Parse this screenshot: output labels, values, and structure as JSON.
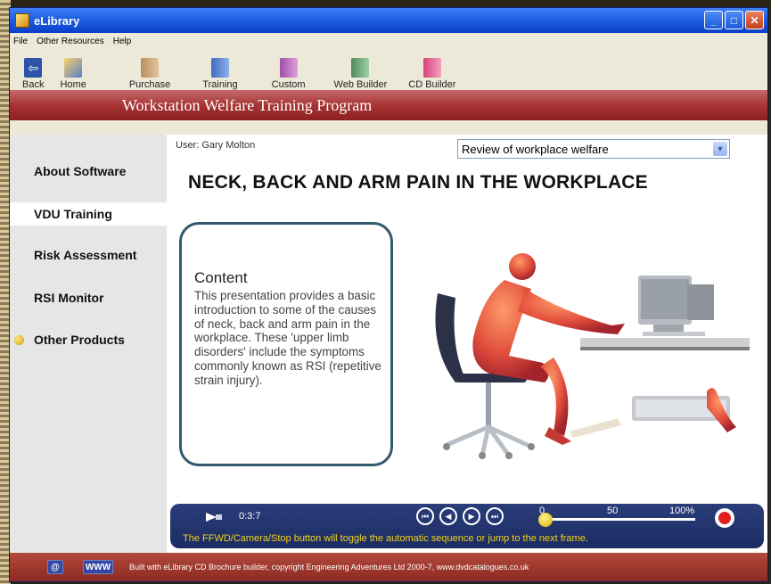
{
  "window": {
    "title": "eLibrary"
  },
  "menu": [
    "File",
    "Other Resources",
    "Help"
  ],
  "toolbar": [
    {
      "label": "Back",
      "icon": "back-arrow-icon"
    },
    {
      "label": "Home",
      "icon": "home-icon"
    },
    {
      "label": "Purchase",
      "icon": "book-icon"
    },
    {
      "label": "Training",
      "icon": "book-icon"
    },
    {
      "label": "Custom",
      "icon": "book-icon"
    },
    {
      "label": "Web Builder",
      "icon": "book-icon"
    },
    {
      "label": "CD Builder",
      "icon": "book-icon"
    }
  ],
  "banner": {
    "title": "Workstation Welfare Training Program"
  },
  "sidebar": {
    "items": [
      {
        "label": "About Software"
      },
      {
        "label": "VDU Training",
        "active": true
      },
      {
        "label": "Risk Assessment"
      },
      {
        "label": "RSI Monitor"
      },
      {
        "label": "Other Products"
      }
    ]
  },
  "main": {
    "user": "User: Gary Molton",
    "topic_select": "Review of workplace welfare",
    "headline": "NECK, BACK AND ARM PAIN IN THE WORKPLACE",
    "content_title": "Content",
    "content_text": "This presentation provides a basic introduction to some of the causes of neck, back and arm pain in the workplace.  These 'upper limb disorders' include the symptoms commonly known as RSI (repetitive strain injury)."
  },
  "player": {
    "time": "0:3:7",
    "scale_min": "0",
    "scale_mid": "50",
    "scale_max": "100%",
    "hint": "The FFWD/Camera/Stop button will toggle the automatic sequence or jump to the next frame."
  },
  "footer": {
    "email_label": "@",
    "www_label": "WWW",
    "text": "Built with eLibrary CD Brochure builder, copyright Engineering Adventures Ltd 2000-7,  www.dvdcatalogues.co.uk"
  },
  "colors": {
    "title_bar": "#1f5fe0",
    "banner": "#a83434",
    "player_bg": "#1c2c62",
    "hint_text": "#f1d21a",
    "footer": "#8d2a22"
  }
}
